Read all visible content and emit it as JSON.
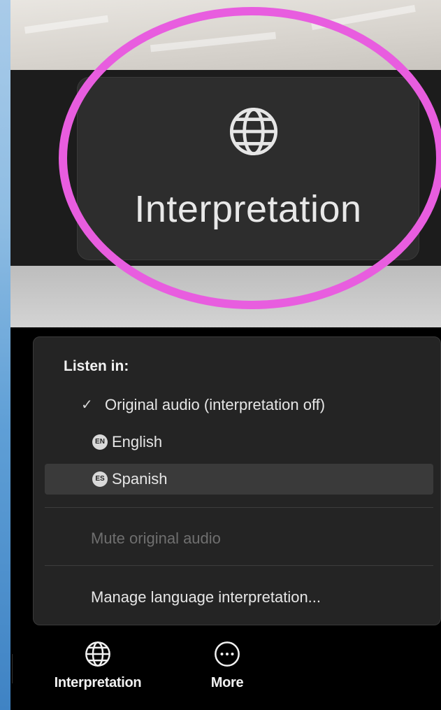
{
  "zoom_view": {
    "button_label": "Interpretation",
    "button_icon": "globe-icon",
    "ring_color": "#e85ddf"
  },
  "menu": {
    "heading": "Listen in:",
    "items": [
      {
        "label": "Original audio (interpretation off)",
        "checked": true
      },
      {
        "badge": "EN",
        "label": "English"
      },
      {
        "badge": "ES",
        "label": "Spanish",
        "highlighted": true
      }
    ],
    "mute_label": "Mute original audio",
    "manage_label": "Manage language interpretation..."
  },
  "toolbar": {
    "interpretation_label": "Interpretation",
    "more_label": "More"
  }
}
